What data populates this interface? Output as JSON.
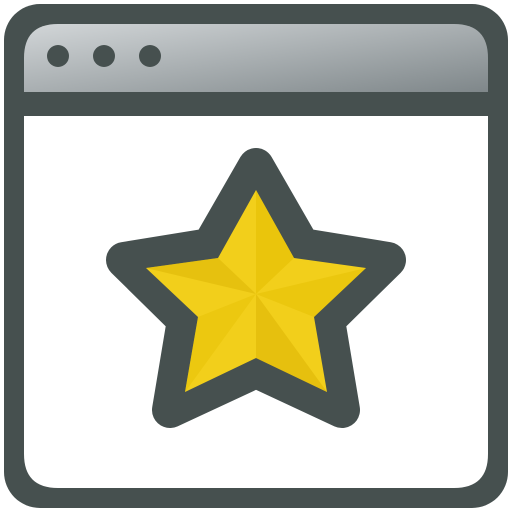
{
  "icon": {
    "name": "browser-window-star-icon",
    "elements": {
      "frame": "window-frame",
      "title_bar": "title-bar",
      "window_dots": [
        "dot-1",
        "dot-2",
        "dot-3"
      ],
      "content": "window-content",
      "emblem": "star-icon"
    }
  },
  "colors": {
    "frame_outline": "#46504f",
    "title_bar": "#8e9598",
    "title_bar_highlight": "#b7bdbf",
    "content_background": "#ffffff",
    "star_fill": "#f2cf1b",
    "star_shadow": "#e0b700",
    "star_outline": "#46504f"
  }
}
